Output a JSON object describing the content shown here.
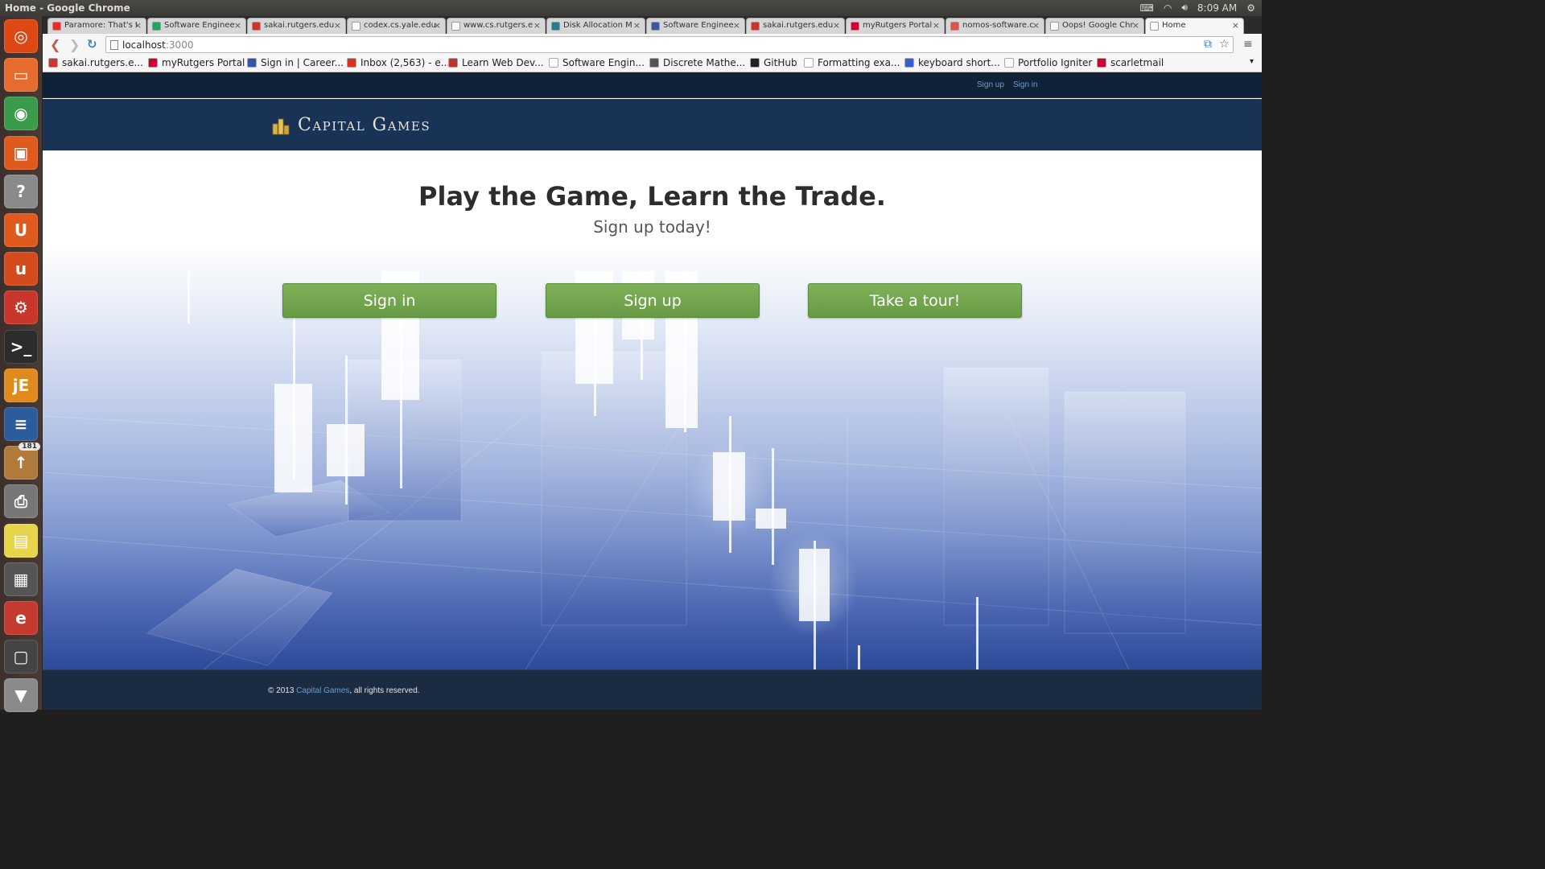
{
  "panel": {
    "window_title": "Home - Google Chrome",
    "time": "8:09 AM"
  },
  "launcher": {
    "items": [
      {
        "name": "ubuntu-dash-icon",
        "glyph": "◎",
        "color": "#dd4814"
      },
      {
        "name": "files-icon",
        "glyph": "▭",
        "color": "#e66b2f"
      },
      {
        "name": "chrome-icon",
        "glyph": "◉",
        "color": "#3a9b4a"
      },
      {
        "name": "software-center-icon",
        "glyph": "▣",
        "color": "#e05a1e"
      },
      {
        "name": "help-icon",
        "glyph": "?",
        "color": "#8a8a8a"
      },
      {
        "name": "ubuntu-one-icon",
        "glyph": "U",
        "color": "#e05a1e"
      },
      {
        "name": "update-manager-icon",
        "glyph": "u",
        "color": "#d64b1e"
      },
      {
        "name": "system-settings-icon",
        "glyph": "⚙",
        "color": "#c9372c"
      },
      {
        "name": "terminal-icon",
        "glyph": ">_",
        "color": "#2c2c2c"
      },
      {
        "name": "jedit-icon",
        "glyph": "jE",
        "color": "#e08a1e"
      },
      {
        "name": "libreoffice-writer-icon",
        "glyph": "≡",
        "color": "#2d5c9a"
      },
      {
        "name": "update-notifier-icon",
        "glyph": "↑",
        "color": "#b07a3a",
        "badge": "181"
      },
      {
        "name": "printer-icon",
        "glyph": "⎙",
        "color": "#777"
      },
      {
        "name": "sticky-notes-icon",
        "glyph": "▤",
        "color": "#e8d44a"
      },
      {
        "name": "calculator-icon",
        "glyph": "▦",
        "color": "#555"
      },
      {
        "name": "eclipse-icon",
        "glyph": "e",
        "color": "#c43a30"
      },
      {
        "name": "workspace-switcher-icon",
        "glyph": "▢",
        "color": "#444"
      },
      {
        "name": "trash-icon",
        "glyph": "▼",
        "color": "#8a8a8a"
      }
    ]
  },
  "tabs": [
    {
      "label": "Paramore: That's t",
      "fav": "#e52d27"
    },
    {
      "label": "Software Enginee",
      "fav": "#21a366"
    },
    {
      "label": "sakai.rutgers.edu",
      "fav": "#cc3333"
    },
    {
      "label": "codex.cs.yale.edu",
      "fav": "#ffffff"
    },
    {
      "label": "www.cs.rutgers.e",
      "fav": "#ffffff"
    },
    {
      "label": "Disk Allocation M",
      "fav": "#2a7a8a"
    },
    {
      "label": "Software Enginee",
      "fav": "#3b5998"
    },
    {
      "label": "sakai.rutgers.edu",
      "fav": "#cc3333"
    },
    {
      "label": "myRutgers Portal",
      "fav": "#cc0033"
    },
    {
      "label": "nomos-software.c",
      "fav": "#d9534f"
    },
    {
      "label": "Oops! Google Chr",
      "fav": "#ffffff"
    },
    {
      "label": "Home",
      "fav": "#ffffff",
      "active": true
    }
  ],
  "omnibox": {
    "host": "localhost",
    "port": ":3000"
  },
  "bookmarks": [
    {
      "label": "sakai.rutgers.e...",
      "fav": "#cc3333"
    },
    {
      "label": "myRutgers Portal",
      "fav": "#cc0033"
    },
    {
      "label": "Sign in | Career...",
      "fav": "#3556a8"
    },
    {
      "label": "Inbox (2,563) - e...",
      "fav": "#d93025"
    },
    {
      "label": "Learn Web Dev...",
      "fav": "#b33"
    },
    {
      "label": "Software Engin...",
      "fav": "#ffffff"
    },
    {
      "label": "Discrete Mathe...",
      "fav": "#555"
    },
    {
      "label": "GitHub",
      "fav": "#222"
    },
    {
      "label": "Formatting exa...",
      "fav": "#ffffff"
    },
    {
      "label": "keyboard short...",
      "fav": "#3a5fcd"
    },
    {
      "label": "Portfolio Igniter",
      "fav": "#ffffff"
    },
    {
      "label": "scarletmail",
      "fav": "#cc0033"
    }
  ],
  "site": {
    "topbar": {
      "signup_link": "Sign up",
      "signin_link": "Sign in"
    },
    "brand": "Capital Games",
    "hero": {
      "title": "Play the Game, Learn the Trade.",
      "subtitle": "Sign up today!",
      "buttons": {
        "signin": "Sign in",
        "signup": "Sign up",
        "tour": "Take a tour!"
      }
    },
    "footer": {
      "prefix": "© 2013 ",
      "brand_link": "Capital Games",
      "suffix": ", all rights reserved."
    }
  },
  "colors": {
    "nav_dark": "#0f2238",
    "header_blue": "#193356",
    "cta_green": "#72a64e",
    "link_blue": "#6f9bd0"
  }
}
